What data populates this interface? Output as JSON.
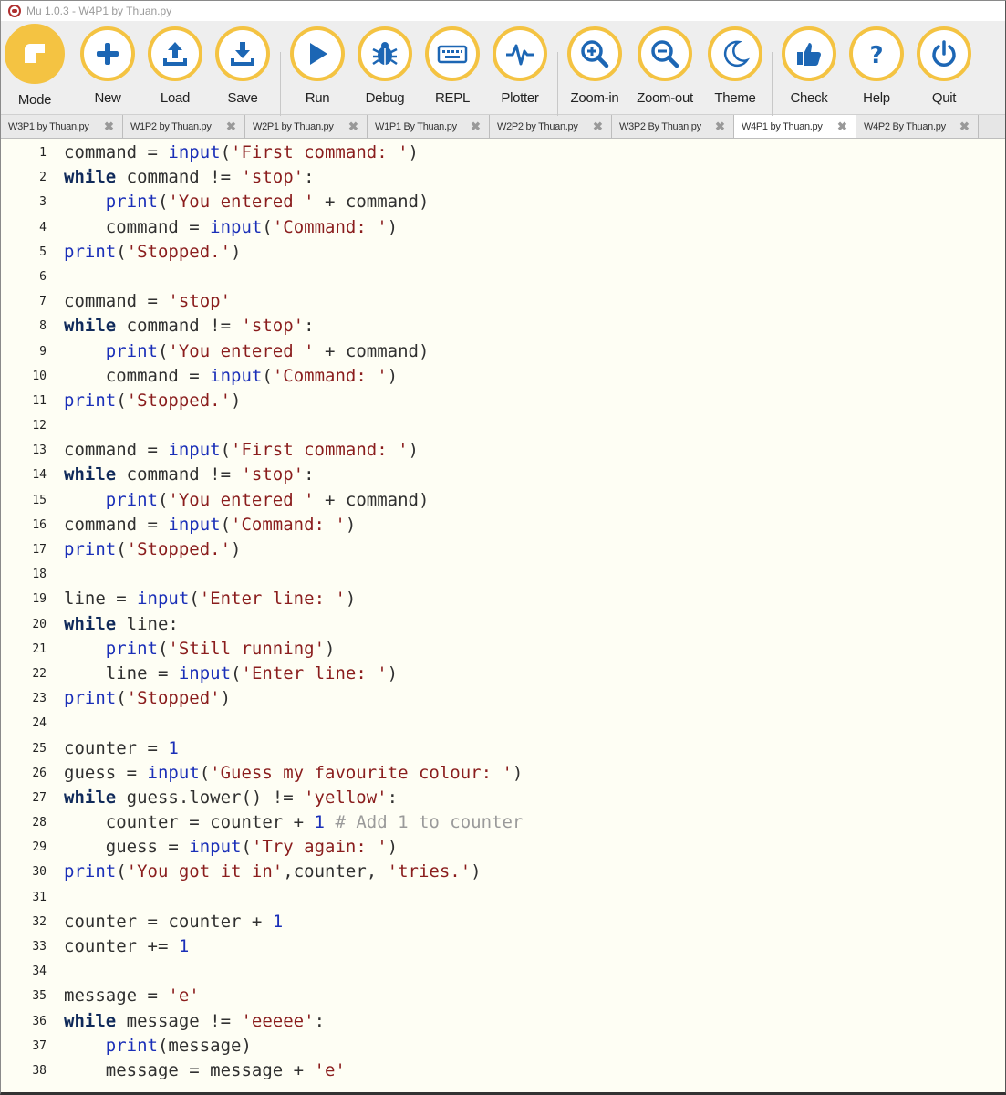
{
  "window": {
    "title": "Mu 1.0.3 - W4P1 by Thuan.py"
  },
  "toolbar": {
    "buttons": [
      {
        "label": "Mode",
        "icon": "mode-icon"
      },
      {
        "label": "New",
        "icon": "plus-icon"
      },
      {
        "label": "Load",
        "icon": "upload-icon"
      },
      {
        "label": "Save",
        "icon": "download-icon"
      },
      {
        "label": "Run",
        "icon": "play-icon"
      },
      {
        "label": "Debug",
        "icon": "bug-icon"
      },
      {
        "label": "REPL",
        "icon": "keyboard-icon"
      },
      {
        "label": "Plotter",
        "icon": "pulse-icon"
      },
      {
        "label": "Zoom-in",
        "icon": "zoom-in-icon"
      },
      {
        "label": "Zoom-out",
        "icon": "zoom-out-icon"
      },
      {
        "label": "Theme",
        "icon": "moon-icon"
      },
      {
        "label": "Check",
        "icon": "thumbs-up-icon"
      },
      {
        "label": "Help",
        "icon": "question-icon"
      },
      {
        "label": "Quit",
        "icon": "power-icon"
      }
    ],
    "accent_color": "#f4c342"
  },
  "tabs": [
    {
      "name": "W3P1 by Thuan.py",
      "active": false
    },
    {
      "name": "W1P2 by Thuan.py",
      "active": false
    },
    {
      "name": "W2P1 by Thuan.py",
      "active": false
    },
    {
      "name": "W1P1 By Thuan.py",
      "active": false
    },
    {
      "name": "W2P2 by Thuan.py",
      "active": false
    },
    {
      "name": "W3P2 By Thuan.py",
      "active": false
    },
    {
      "name": "W4P1 by Thuan.py",
      "active": true
    },
    {
      "name": "W4P2 By Thuan.py",
      "active": false
    }
  ],
  "editor": {
    "lines": [
      "command = input('First command: ')",
      "while command != 'stop':",
      "    print('You entered ' + command)",
      "    command = input('Command: ')",
      "print('Stopped.')",
      "",
      "command = 'stop'",
      "while command != 'stop':",
      "    print('You entered ' + command)",
      "    command = input('Command: ')",
      "print('Stopped.')",
      "",
      "command = input('First command: ')",
      "while command != 'stop':",
      "    print('You entered ' + command)",
      "command = input('Command: ')",
      "print('Stopped.')",
      "",
      "line = input('Enter line: ')",
      "while line:",
      "    print('Still running')",
      "    line = input('Enter line: ')",
      "print('Stopped')",
      "",
      "counter = 1",
      "guess = input('Guess my favourite colour: ')",
      "while guess.lower() != 'yellow':",
      "    counter = counter + 1 # Add 1 to counter",
      "    guess = input('Try again: ')",
      "print('You got it in',counter, 'tries.')",
      "",
      "counter = counter + 1",
      "counter += 1",
      "",
      "message = 'e'",
      "while message != 'eeeee':",
      "    print(message)",
      "    message = message + 'e'"
    ]
  }
}
